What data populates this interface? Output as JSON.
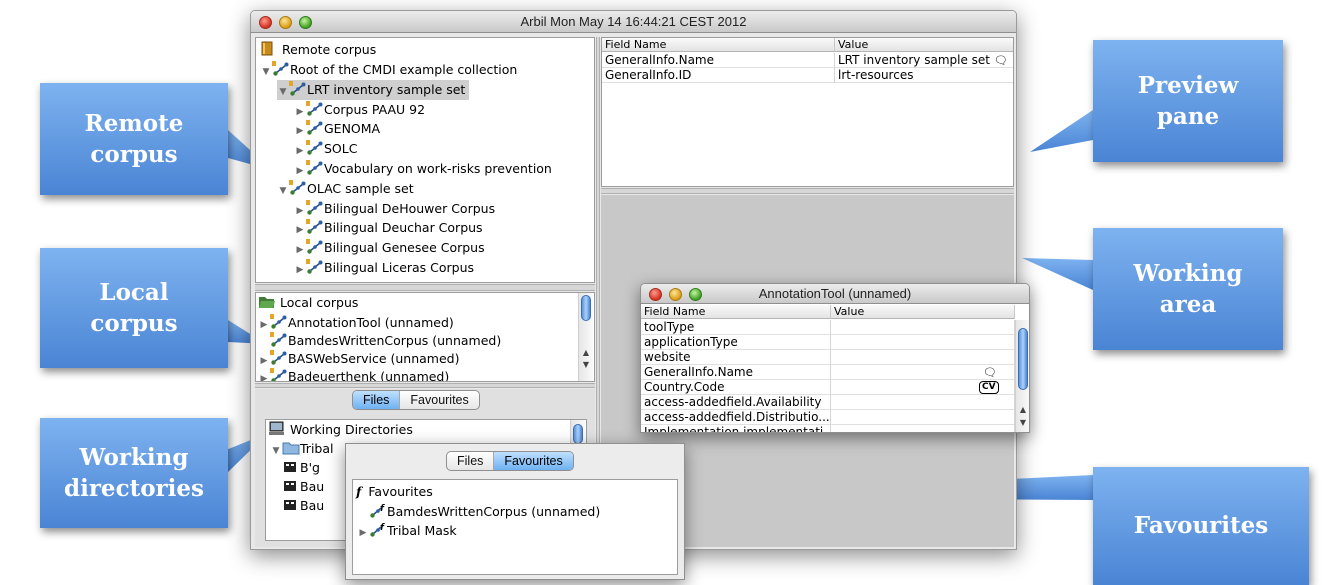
{
  "window": {
    "title": "Arbil Mon May 14 16:44:21 CEST 2012"
  },
  "remote_corpus": {
    "root_label": "Remote corpus",
    "items": [
      {
        "label": "Root of the CMDI example collection",
        "level": 1,
        "expanded": true
      },
      {
        "label": "LRT inventory sample set",
        "level": 2,
        "expanded": true,
        "selected": true
      },
      {
        "label": "Corpus PAAU 92",
        "level": 3,
        "expanded": false
      },
      {
        "label": "GENOMA",
        "level": 3,
        "expanded": false
      },
      {
        "label": "SOLC",
        "level": 3,
        "expanded": false
      },
      {
        "label": "Vocabulary on work-risks prevention",
        "level": 3,
        "expanded": false
      },
      {
        "label": "OLAC sample set",
        "level": 2,
        "expanded": true
      },
      {
        "label": "Bilingual DeHouwer Corpus",
        "level": 3,
        "expanded": false
      },
      {
        "label": "Bilingual Deuchar Corpus",
        "level": 3,
        "expanded": false
      },
      {
        "label": "Bilingual Genesee Corpus",
        "level": 3,
        "expanded": false
      },
      {
        "label": "Bilingual Liceras Corpus",
        "level": 3,
        "expanded": false
      }
    ]
  },
  "local_corpus": {
    "root_label": "Local corpus",
    "items": [
      {
        "label": "AnnotationTool (unnamed)",
        "expandable": true
      },
      {
        "label": "BamdesWrittenCorpus (unnamed)",
        "expandable": false
      },
      {
        "label": "BASWebService (unnamed)",
        "expandable": true
      },
      {
        "label": "Badeuerthenk (unnamed)",
        "expandable": true
      }
    ]
  },
  "file_tabs": {
    "files_label": "Files",
    "favourites_label": "Favourites",
    "active": "Files"
  },
  "working_dirs": {
    "root_label": "Working Directories",
    "items": [
      {
        "label": "Tribal"
      },
      {
        "label": "B'g"
      },
      {
        "label": "Bau"
      },
      {
        "label": "Bau"
      }
    ]
  },
  "preview": {
    "headers": {
      "field": "Field Name",
      "value": "Value"
    },
    "rows": [
      {
        "field": "GeneralInfo.Name",
        "value": "LRT inventory sample set",
        "icon": "speech-bubble-icon"
      },
      {
        "field": "GeneralInfo.ID",
        "value": "lrt-resources",
        "icon": ""
      }
    ]
  },
  "annotation_window": {
    "title": "AnnotationTool (unnamed)",
    "headers": {
      "field": "Field Name",
      "value": "Value"
    },
    "rows": [
      {
        "field": "toolType",
        "value": "",
        "icon": ""
      },
      {
        "field": "applicationType",
        "value": "",
        "icon": ""
      },
      {
        "field": "website",
        "value": "",
        "icon": ""
      },
      {
        "field": "GeneralInfo.Name",
        "value": "",
        "icon": "speech-bubble-icon"
      },
      {
        "field": "Country.Code",
        "value": "",
        "icon": "cv-icon"
      },
      {
        "field": "access-addedfield.Availability",
        "value": "",
        "icon": ""
      },
      {
        "field": "access-addedfield.Distributio...",
        "value": "",
        "icon": ""
      },
      {
        "field": "Implementation.implementati...",
        "value": "",
        "icon": ""
      }
    ],
    "cv_badge": "CV"
  },
  "favourites_window": {
    "tabs": {
      "files_label": "Files",
      "favourites_label": "Favourites",
      "active": "Favourites"
    },
    "root_label": "Favourites",
    "items": [
      {
        "label": "BamdesWrittenCorpus (unnamed)",
        "expandable": false
      },
      {
        "label": "Tribal Mask",
        "expandable": true
      }
    ]
  },
  "callouts": {
    "remote": [
      "Remote",
      "corpus"
    ],
    "local": [
      "Local",
      "corpus"
    ],
    "working_dirs": [
      "Working",
      "directories"
    ],
    "preview": [
      "Preview",
      "pane"
    ],
    "working_area": [
      "Working",
      "area"
    ],
    "favourites": [
      "Favourites"
    ]
  },
  "colors": {
    "callout_top": "#7eb3f0",
    "callout_bottom": "#4a84d4",
    "selection": "#cfcfcf",
    "tab_active": "#6fb1f2"
  }
}
